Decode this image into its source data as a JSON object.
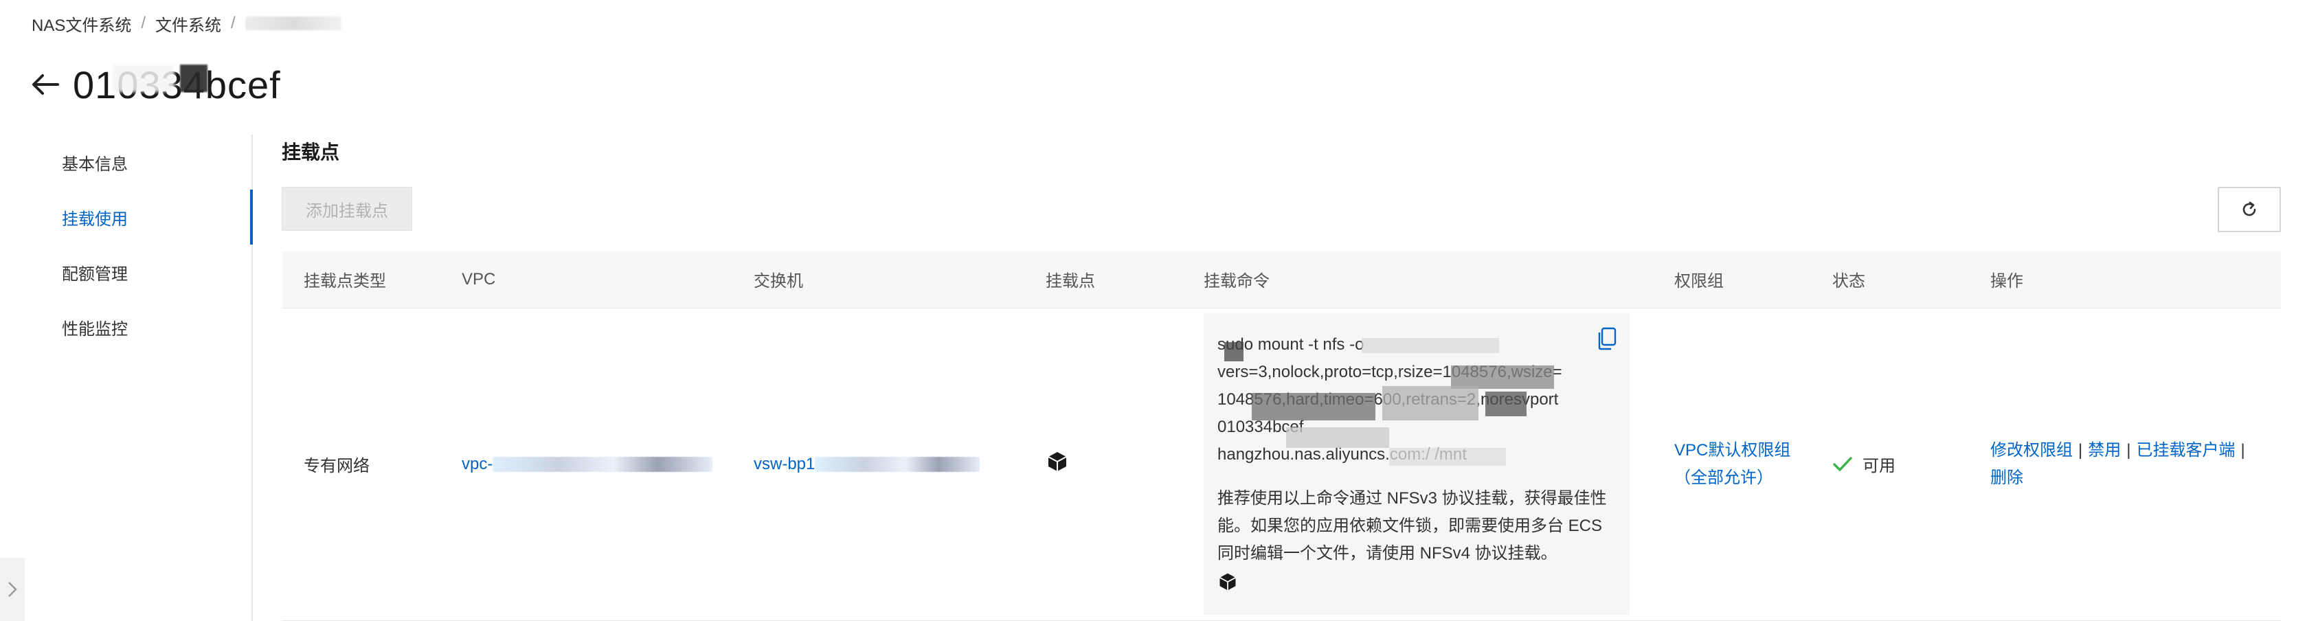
{
  "breadcrumb": {
    "items": [
      "NAS文件系统",
      "文件系统"
    ],
    "current_redacted": true
  },
  "page": {
    "title": "010334bcef"
  },
  "sidebar": {
    "items": [
      {
        "label": "基本信息",
        "active": false
      },
      {
        "label": "挂载使用",
        "active": true
      },
      {
        "label": "配额管理",
        "active": false
      },
      {
        "label": "性能监控",
        "active": false
      }
    ]
  },
  "main": {
    "section_title": "挂载点",
    "add_button": "添加挂载点",
    "columns": [
      "挂载点类型",
      "VPC",
      "交换机",
      "挂载点",
      "挂载命令",
      "权限组",
      "状态",
      "操作"
    ],
    "row": {
      "type": "专有网络",
      "vpc": "vpc-",
      "vswitch": "vsw-bp1",
      "mount_cmd_lines": [
        "sudo mount -t nfs -o",
        "vers=3,nolock,proto=tcp,rsize=1048576,wsize=",
        "1048576,hard,timeo=600,retrans=2,noresvport",
        "010334bcef",
        "hangzhou.nas.aliyuncs.com:/ /mnt"
      ],
      "mount_note": "推荐使用以上命令通过 NFSv3 协议挂载，获得最佳性能。如果您的应用依赖文件锁，即需要使用多台 ECS 同时编辑一个文件，请使用 NFSv4 协议挂载。",
      "permission_group": "VPC默认权限组（全部允许）",
      "status": "可用",
      "actions": [
        "修改权限组",
        "禁用",
        "已挂载客户端",
        "删除"
      ]
    }
  },
  "colors": {
    "accent": "#0064c8",
    "status_ok": "#3bb346",
    "header_bg": "#f7f7f7",
    "disabled_btn_bg": "#ececec"
  },
  "icons": [
    "back-arrow-icon",
    "refresh-icon",
    "cube-icon",
    "copy-icon",
    "check-icon",
    "chevron-right-icon"
  ]
}
